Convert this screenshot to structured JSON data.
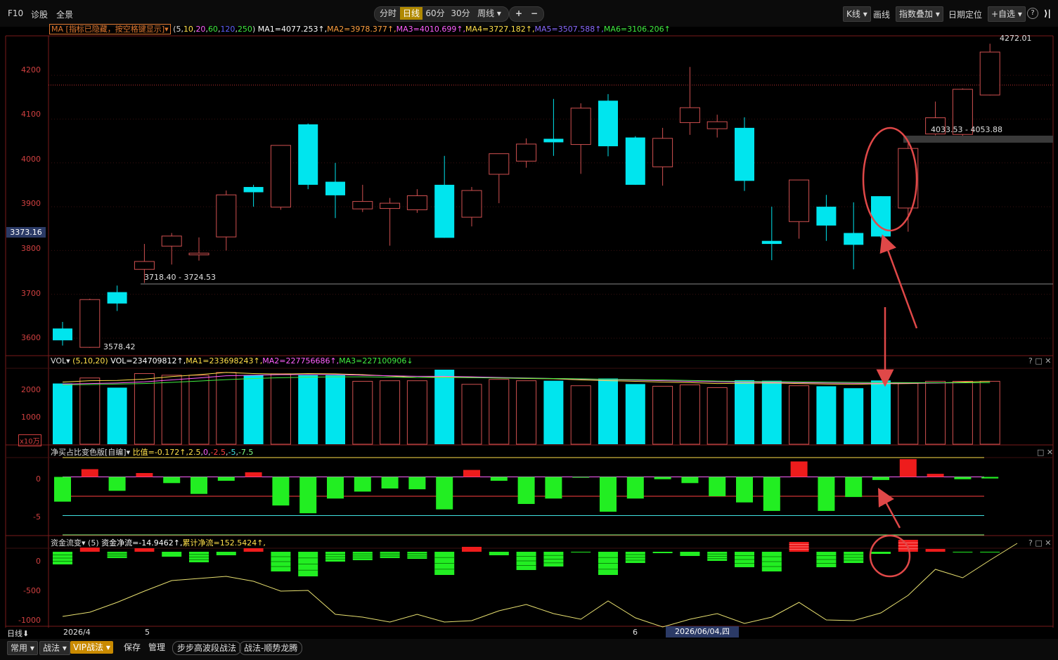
{
  "toolbar": {
    "left_items": [
      "F10",
      "诊股",
      "全景"
    ],
    "periods": [
      "分时",
      "日线",
      "60分",
      "30分",
      "周线"
    ],
    "active_period": "日线",
    "zoom_in": "+",
    "zoom_out": "−",
    "chart_type": "K线",
    "draw": "画线",
    "overlay": "指数叠加",
    "date_locate": "日期定位",
    "add_watch": "+自选",
    "help": "?",
    "exit": "⟩|"
  },
  "ma_legend": {
    "name": "MA",
    "hidden_note": "指标已隐藏，按空格键显示",
    "params_open": "(",
    "params": [
      "5",
      "10",
      "20",
      "60",
      "120",
      "250"
    ],
    "params_close": ")",
    "ma1": "MA1=4077.253↑,",
    "ma2": "MA2=3978.377↑,",
    "ma3": "MA3=4010.699↑,",
    "ma4": "MA4=3727.182↑,",
    "ma5": "MA5=3507.588↑,",
    "ma6": "MA6=3106.206↑"
  },
  "main_chart": {
    "price_ticks": [
      "4200",
      "4100",
      "4000",
      "3900",
      "3800",
      "3700",
      "3600"
    ],
    "cursor_price": "3373.16",
    "range_label_1": "3718.40 - 3724.53",
    "range_label_2": "4033.53 - 4053.88",
    "high_label": "4272.01",
    "low_label": "3578.42"
  },
  "vol_legend": {
    "name": "VOL",
    "params": "(5,10,20)",
    "vol": "VOL=234709812↑,",
    "ma1": "MA1=233698243↑,",
    "ma2": "MA2=227756686↑,",
    "ma3": "MA3=227100906↓",
    "ticks": [
      "2000",
      "1000"
    ],
    "unit": "x10万"
  },
  "net_legend": {
    "name": "净买占比变色版[自编]",
    "ratio": "比值=-0.172↑,",
    "levels": [
      "2.5",
      "0",
      "-2.5",
      "-5",
      "-7.5"
    ],
    "ticks": [
      "0",
      "-5"
    ]
  },
  "flow_legend": {
    "name": "资金流变",
    "param": "(5)",
    "net": "资金净流=-14.9462↑,",
    "cum": "累计净流=152.5424↑,",
    "ticks": [
      "0",
      "-500",
      "-1000"
    ]
  },
  "panel_controls": [
    "?",
    "□",
    "✕"
  ],
  "axis": {
    "period_label": "日线",
    "date1": "2026/4",
    "date2": "5",
    "date3": "6",
    "cursor_date": "2026/06/04,四"
  },
  "bottom_tabs": [
    "常用",
    "战法",
    "VIP战法",
    "保存",
    "管理",
    "步步高波段战法",
    "战法-顺势龙腾"
  ],
  "colors": {
    "up": "#ff3b3b",
    "down": "#00e5ee",
    "green": "#22ee22",
    "accent": "#b08900"
  },
  "chart_data": [
    {
      "type": "candlestick",
      "title": "",
      "ylim": [
        3560,
        4290
      ],
      "candles": [
        {
          "o": 3622,
          "c": 3595,
          "h": 3637,
          "l": 3583
        },
        {
          "o": 3579,
          "c": 3688,
          "h": 3690,
          "l": 3578
        },
        {
          "o": 3705,
          "c": 3679,
          "h": 3720,
          "l": 3662
        },
        {
          "o": 3757,
          "c": 3775,
          "h": 3815,
          "l": 3726
        },
        {
          "o": 3810,
          "c": 3833,
          "h": 3840,
          "l": 3768
        },
        {
          "o": 3790,
          "c": 3794,
          "h": 3830,
          "l": 3777
        },
        {
          "o": 3831,
          "c": 3927,
          "h": 3937,
          "l": 3800
        },
        {
          "o": 3945,
          "c": 3933,
          "h": 3950,
          "l": 3900
        },
        {
          "o": 3899,
          "c": 4040,
          "h": 4040,
          "l": 3893
        },
        {
          "o": 4088,
          "c": 3950,
          "h": 4090,
          "l": 3940
        },
        {
          "o": 3957,
          "c": 3926,
          "h": 4000,
          "l": 3874
        },
        {
          "o": 3895,
          "c": 3912,
          "h": 3950,
          "l": 3888
        },
        {
          "o": 3896,
          "c": 3908,
          "h": 3920,
          "l": 3811
        },
        {
          "o": 3893,
          "c": 3925,
          "h": 3940,
          "l": 3886
        },
        {
          "o": 3950,
          "c": 3829,
          "h": 4016,
          "l": 3829
        },
        {
          "o": 3876,
          "c": 3937,
          "h": 3945,
          "l": 3855
        },
        {
          "o": 3974,
          "c": 4021,
          "h": 4021,
          "l": 3908
        },
        {
          "o": 4004,
          "c": 4043,
          "h": 4056,
          "l": 3989
        },
        {
          "o": 4055,
          "c": 4047,
          "h": 4146,
          "l": 4016
        },
        {
          "o": 4042,
          "c": 4125,
          "h": 4136,
          "l": 3975
        },
        {
          "o": 4142,
          "c": 4038,
          "h": 4157,
          "l": 4015
        },
        {
          "o": 4058,
          "c": 3950,
          "h": 4061,
          "l": 3950
        },
        {
          "o": 3991,
          "c": 4056,
          "h": 4080,
          "l": 3948
        },
        {
          "o": 4092,
          "c": 4126,
          "h": 4219,
          "l": 4064
        },
        {
          "o": 4078,
          "c": 4094,
          "h": 4110,
          "l": 4058
        },
        {
          "o": 4080,
          "c": 3959,
          "h": 4104,
          "l": 3936
        },
        {
          "o": 3822,
          "c": 3815,
          "h": 3900,
          "l": 3778
        },
        {
          "o": 3866,
          "c": 3961,
          "h": 3961,
          "l": 3827
        },
        {
          "o": 3900,
          "c": 3857,
          "h": 3927,
          "l": 3822
        },
        {
          "o": 3840,
          "c": 3813,
          "h": 3910,
          "l": 3757
        },
        {
          "o": 3924,
          "c": 3832,
          "h": 3924,
          "l": 3829
        },
        {
          "o": 3897,
          "c": 4033,
          "h": 4050,
          "l": 3843
        },
        {
          "o": 4066,
          "c": 4103,
          "h": 4140,
          "l": 4063
        },
        {
          "o": 4065,
          "c": 4168,
          "h": 4170,
          "l": 4062
        },
        {
          "o": 4155,
          "c": 4253,
          "h": 4272,
          "l": 4154
        }
      ]
    },
    {
      "type": "bar",
      "title": "VOL",
      "ylim": [
        0,
        2750
      ],
      "values": [
        2200,
        2400,
        2050,
        2560,
        2500,
        2500,
        2600,
        2500,
        2550,
        2500,
        2500,
        2280,
        2300,
        2300,
        2700,
        2170,
        2350,
        2300,
        2300,
        2120,
        2380,
        2180,
        2100,
        2150,
        2050,
        2320,
        2300,
        2120,
        2100,
        2030,
        2310,
        2200,
        2280,
        2280,
        2280
      ],
      "series": [
        {
          "name": "MA1",
          "values": [
            2250,
            2300,
            2310,
            2360,
            2450,
            2520,
            2600,
            2560,
            2540,
            2560,
            2550,
            2520,
            2470,
            2420,
            2440,
            2420,
            2400,
            2380,
            2370,
            2330,
            2300,
            2280,
            2250,
            2230,
            2200,
            2210,
            2220,
            2200,
            2180,
            2170,
            2190,
            2200,
            2220,
            2250,
            2280
          ]
        },
        {
          "name": "MA2",
          "values": [
            2180,
            2200,
            2220,
            2260,
            2330,
            2400,
            2480,
            2500,
            2520,
            2520,
            2520,
            2500,
            2480,
            2460,
            2460,
            2440,
            2420,
            2400,
            2380,
            2360,
            2340,
            2320,
            2300,
            2280,
            2260,
            2250,
            2240,
            2230,
            2220,
            2210,
            2210,
            2215,
            2220,
            2225,
            2230
          ]
        },
        {
          "name": "MA3",
          "values": [
            2150,
            2160,
            2180,
            2200,
            2240,
            2290,
            2340,
            2380,
            2410,
            2430,
            2440,
            2440,
            2430,
            2420,
            2420,
            2410,
            2400,
            2390,
            2380,
            2370,
            2350,
            2340,
            2330,
            2310,
            2290,
            2280,
            2270,
            2260,
            2250,
            2240,
            2235,
            2230,
            2230,
            2228,
            2227
          ]
        }
      ]
    },
    {
      "type": "bar",
      "title": "净买占比变色版[自编]",
      "ylim": [
        -7.5,
        2.5
      ],
      "values": [
        -3.2,
        1.0,
        -1.8,
        0.5,
        -0.8,
        -2.2,
        -0.5,
        0.6,
        -3.7,
        -4.7,
        -2.8,
        -1.9,
        -1.5,
        -1.6,
        -4.2,
        0.9,
        -0.5,
        -3.5,
        -2.8,
        -0.1,
        -4.5,
        -2.8,
        -0.3,
        -0.8,
        -2.5,
        -3.3,
        -4.4,
        2.0,
        -4.4,
        -2.6,
        -0.4,
        2.3,
        0.4,
        -0.3,
        -0.2
      ]
    },
    {
      "type": "bar",
      "title": "资金流变",
      "ylim": [
        -1050,
        50
      ],
      "values": [
        -180,
        60,
        -90,
        50,
        -70,
        -150,
        -50,
        50,
        -280,
        -350,
        -140,
        -120,
        -90,
        -100,
        -330,
        70,
        -50,
        -260,
        -210,
        -5,
        -330,
        -160,
        -20,
        -60,
        -130,
        -220,
        -280,
        140,
        -220,
        -160,
        -30,
        170,
        40,
        -10,
        -5
      ],
      "series": [
        {
          "name": "累计净流",
          "values": [
            -920,
            -860,
            -720,
            -560,
            -410,
            -380,
            -350,
            -420,
            -560,
            -550,
            -890,
            -930,
            -1000,
            -890,
            -1000,
            -980,
            -840,
            -750,
            -880,
            -960,
            -700,
            -940,
            -1070,
            -960,
            -880,
            -1020,
            -930,
            -720,
            -970,
            -980,
            -870,
            -620,
            -250,
            -370,
            -120,
            120
          ]
        }
      ]
    }
  ]
}
